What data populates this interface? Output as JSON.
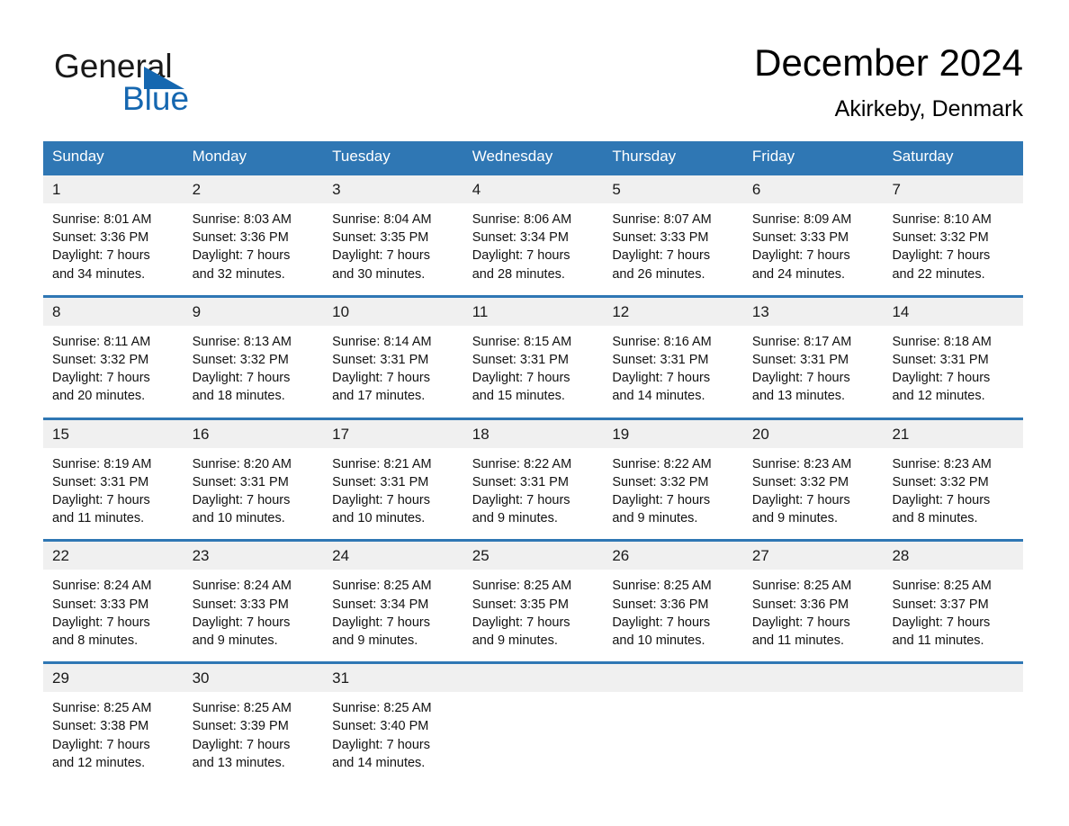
{
  "brand": {
    "name_part1": "General",
    "name_part2": "Blue",
    "logo_icon": "blue-triangle-flag",
    "color_primary": "#1567b0"
  },
  "header": {
    "title": "December 2024",
    "subtitle": "Akirkeby, Denmark"
  },
  "theme": {
    "header_blue": "#2f77b4",
    "row_band_gray": "#f0f0f0",
    "text_black": "#111111"
  },
  "calendar": {
    "weekday_headers": [
      "Sunday",
      "Monday",
      "Tuesday",
      "Wednesday",
      "Thursday",
      "Friday",
      "Saturday"
    ],
    "weeks": [
      {
        "days": [
          {
            "num": "1",
            "sunrise": "Sunrise: 8:01 AM",
            "sunset": "Sunset: 3:36 PM",
            "daylight_line1": "Daylight: 7 hours",
            "daylight_line2": "and 34 minutes."
          },
          {
            "num": "2",
            "sunrise": "Sunrise: 8:03 AM",
            "sunset": "Sunset: 3:36 PM",
            "daylight_line1": "Daylight: 7 hours",
            "daylight_line2": "and 32 minutes."
          },
          {
            "num": "3",
            "sunrise": "Sunrise: 8:04 AM",
            "sunset": "Sunset: 3:35 PM",
            "daylight_line1": "Daylight: 7 hours",
            "daylight_line2": "and 30 minutes."
          },
          {
            "num": "4",
            "sunrise": "Sunrise: 8:06 AM",
            "sunset": "Sunset: 3:34 PM",
            "daylight_line1": "Daylight: 7 hours",
            "daylight_line2": "and 28 minutes."
          },
          {
            "num": "5",
            "sunrise": "Sunrise: 8:07 AM",
            "sunset": "Sunset: 3:33 PM",
            "daylight_line1": "Daylight: 7 hours",
            "daylight_line2": "and 26 minutes."
          },
          {
            "num": "6",
            "sunrise": "Sunrise: 8:09 AM",
            "sunset": "Sunset: 3:33 PM",
            "daylight_line1": "Daylight: 7 hours",
            "daylight_line2": "and 24 minutes."
          },
          {
            "num": "7",
            "sunrise": "Sunrise: 8:10 AM",
            "sunset": "Sunset: 3:32 PM",
            "daylight_line1": "Daylight: 7 hours",
            "daylight_line2": "and 22 minutes."
          }
        ]
      },
      {
        "days": [
          {
            "num": "8",
            "sunrise": "Sunrise: 8:11 AM",
            "sunset": "Sunset: 3:32 PM",
            "daylight_line1": "Daylight: 7 hours",
            "daylight_line2": "and 20 minutes."
          },
          {
            "num": "9",
            "sunrise": "Sunrise: 8:13 AM",
            "sunset": "Sunset: 3:32 PM",
            "daylight_line1": "Daylight: 7 hours",
            "daylight_line2": "and 18 minutes."
          },
          {
            "num": "10",
            "sunrise": "Sunrise: 8:14 AM",
            "sunset": "Sunset: 3:31 PM",
            "daylight_line1": "Daylight: 7 hours",
            "daylight_line2": "and 17 minutes."
          },
          {
            "num": "11",
            "sunrise": "Sunrise: 8:15 AM",
            "sunset": "Sunset: 3:31 PM",
            "daylight_line1": "Daylight: 7 hours",
            "daylight_line2": "and 15 minutes."
          },
          {
            "num": "12",
            "sunrise": "Sunrise: 8:16 AM",
            "sunset": "Sunset: 3:31 PM",
            "daylight_line1": "Daylight: 7 hours",
            "daylight_line2": "and 14 minutes."
          },
          {
            "num": "13",
            "sunrise": "Sunrise: 8:17 AM",
            "sunset": "Sunset: 3:31 PM",
            "daylight_line1": "Daylight: 7 hours",
            "daylight_line2": "and 13 minutes."
          },
          {
            "num": "14",
            "sunrise": "Sunrise: 8:18 AM",
            "sunset": "Sunset: 3:31 PM",
            "daylight_line1": "Daylight: 7 hours",
            "daylight_line2": "and 12 minutes."
          }
        ]
      },
      {
        "days": [
          {
            "num": "15",
            "sunrise": "Sunrise: 8:19 AM",
            "sunset": "Sunset: 3:31 PM",
            "daylight_line1": "Daylight: 7 hours",
            "daylight_line2": "and 11 minutes."
          },
          {
            "num": "16",
            "sunrise": "Sunrise: 8:20 AM",
            "sunset": "Sunset: 3:31 PM",
            "daylight_line1": "Daylight: 7 hours",
            "daylight_line2": "and 10 minutes."
          },
          {
            "num": "17",
            "sunrise": "Sunrise: 8:21 AM",
            "sunset": "Sunset: 3:31 PM",
            "daylight_line1": "Daylight: 7 hours",
            "daylight_line2": "and 10 minutes."
          },
          {
            "num": "18",
            "sunrise": "Sunrise: 8:22 AM",
            "sunset": "Sunset: 3:31 PM",
            "daylight_line1": "Daylight: 7 hours",
            "daylight_line2": "and 9 minutes."
          },
          {
            "num": "19",
            "sunrise": "Sunrise: 8:22 AM",
            "sunset": "Sunset: 3:32 PM",
            "daylight_line1": "Daylight: 7 hours",
            "daylight_line2": "and 9 minutes."
          },
          {
            "num": "20",
            "sunrise": "Sunrise: 8:23 AM",
            "sunset": "Sunset: 3:32 PM",
            "daylight_line1": "Daylight: 7 hours",
            "daylight_line2": "and 9 minutes."
          },
          {
            "num": "21",
            "sunrise": "Sunrise: 8:23 AM",
            "sunset": "Sunset: 3:32 PM",
            "daylight_line1": "Daylight: 7 hours",
            "daylight_line2": "and 8 minutes."
          }
        ]
      },
      {
        "days": [
          {
            "num": "22",
            "sunrise": "Sunrise: 8:24 AM",
            "sunset": "Sunset: 3:33 PM",
            "daylight_line1": "Daylight: 7 hours",
            "daylight_line2": "and 8 minutes."
          },
          {
            "num": "23",
            "sunrise": "Sunrise: 8:24 AM",
            "sunset": "Sunset: 3:33 PM",
            "daylight_line1": "Daylight: 7 hours",
            "daylight_line2": "and 9 minutes."
          },
          {
            "num": "24",
            "sunrise": "Sunrise: 8:25 AM",
            "sunset": "Sunset: 3:34 PM",
            "daylight_line1": "Daylight: 7 hours",
            "daylight_line2": "and 9 minutes."
          },
          {
            "num": "25",
            "sunrise": "Sunrise: 8:25 AM",
            "sunset": "Sunset: 3:35 PM",
            "daylight_line1": "Daylight: 7 hours",
            "daylight_line2": "and 9 minutes."
          },
          {
            "num": "26",
            "sunrise": "Sunrise: 8:25 AM",
            "sunset": "Sunset: 3:36 PM",
            "daylight_line1": "Daylight: 7 hours",
            "daylight_line2": "and 10 minutes."
          },
          {
            "num": "27",
            "sunrise": "Sunrise: 8:25 AM",
            "sunset": "Sunset: 3:36 PM",
            "daylight_line1": "Daylight: 7 hours",
            "daylight_line2": "and 11 minutes."
          },
          {
            "num": "28",
            "sunrise": "Sunrise: 8:25 AM",
            "sunset": "Sunset: 3:37 PM",
            "daylight_line1": "Daylight: 7 hours",
            "daylight_line2": "and 11 minutes."
          }
        ]
      },
      {
        "days": [
          {
            "num": "29",
            "sunrise": "Sunrise: 8:25 AM",
            "sunset": "Sunset: 3:38 PM",
            "daylight_line1": "Daylight: 7 hours",
            "daylight_line2": "and 12 minutes."
          },
          {
            "num": "30",
            "sunrise": "Sunrise: 8:25 AM",
            "sunset": "Sunset: 3:39 PM",
            "daylight_line1": "Daylight: 7 hours",
            "daylight_line2": "and 13 minutes."
          },
          {
            "num": "31",
            "sunrise": "Sunrise: 8:25 AM",
            "sunset": "Sunset: 3:40 PM",
            "daylight_line1": "Daylight: 7 hours",
            "daylight_line2": "and 14 minutes."
          },
          {
            "num": "",
            "sunrise": "",
            "sunset": "",
            "daylight_line1": "",
            "daylight_line2": ""
          },
          {
            "num": "",
            "sunrise": "",
            "sunset": "",
            "daylight_line1": "",
            "daylight_line2": ""
          },
          {
            "num": "",
            "sunrise": "",
            "sunset": "",
            "daylight_line1": "",
            "daylight_line2": ""
          },
          {
            "num": "",
            "sunrise": "",
            "sunset": "",
            "daylight_line1": "",
            "daylight_line2": ""
          }
        ]
      }
    ]
  }
}
